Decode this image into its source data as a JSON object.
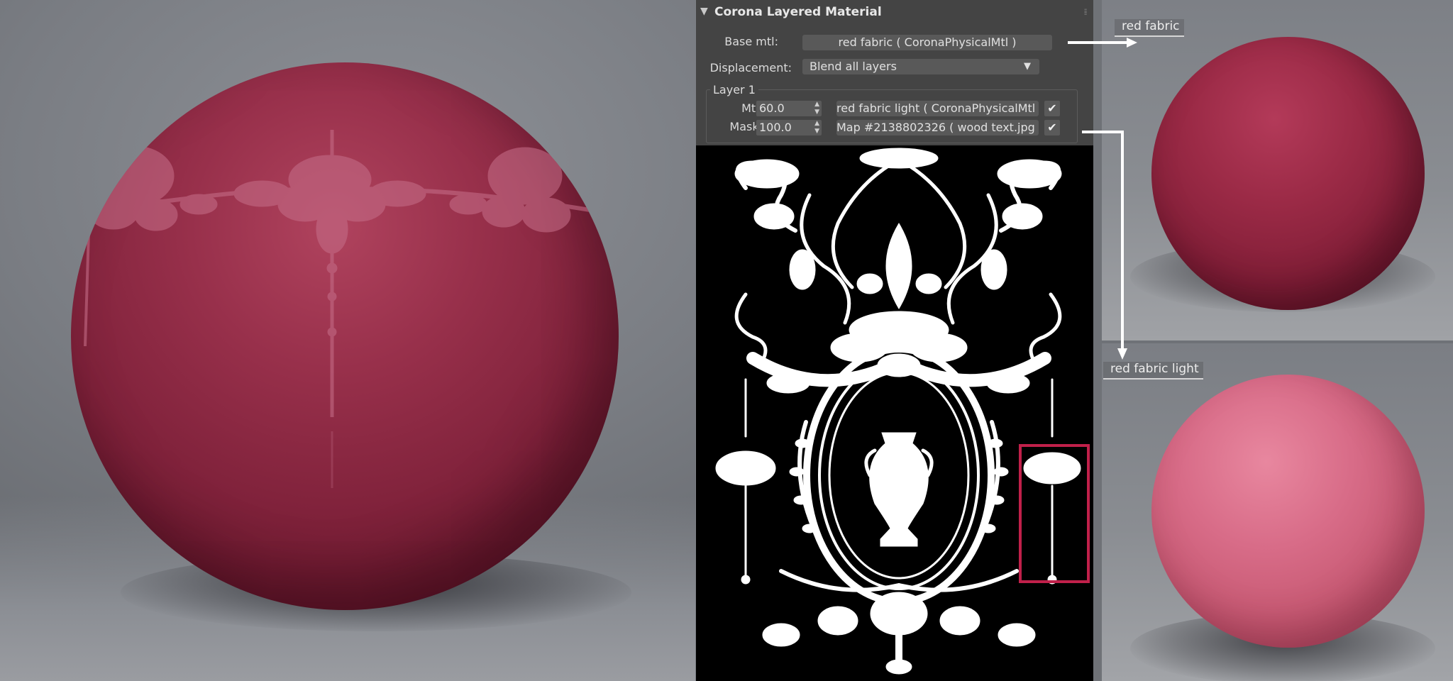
{
  "panel": {
    "title": "Corona Layered Material",
    "base_label": "Base mtl:",
    "base_value": "red fabric  (  CoronaPhysicalMtl  )",
    "displacement_label": "Displacement:",
    "displacement_value": "Blend all layers",
    "layer_group_label": "Layer 1",
    "mtl_label": "Mtl:",
    "mtl_amount": "60.0",
    "mtl_value": "red fabric light  (  CoronaPhysicalMtl  )",
    "mask_label": "Mask:",
    "mask_amount": "100.0",
    "mask_value": "Map #2138802326 ( wood text.jpg )",
    "check_glyph": "✔"
  },
  "thumbnails": {
    "top_label": "red fabric",
    "bottom_label": "red fabric light"
  },
  "colors": {
    "accent_box": "#c0204a",
    "panel_bg": "#444444",
    "fabric_red": "#9b2a46",
    "fabric_pink": "#d86c88"
  }
}
